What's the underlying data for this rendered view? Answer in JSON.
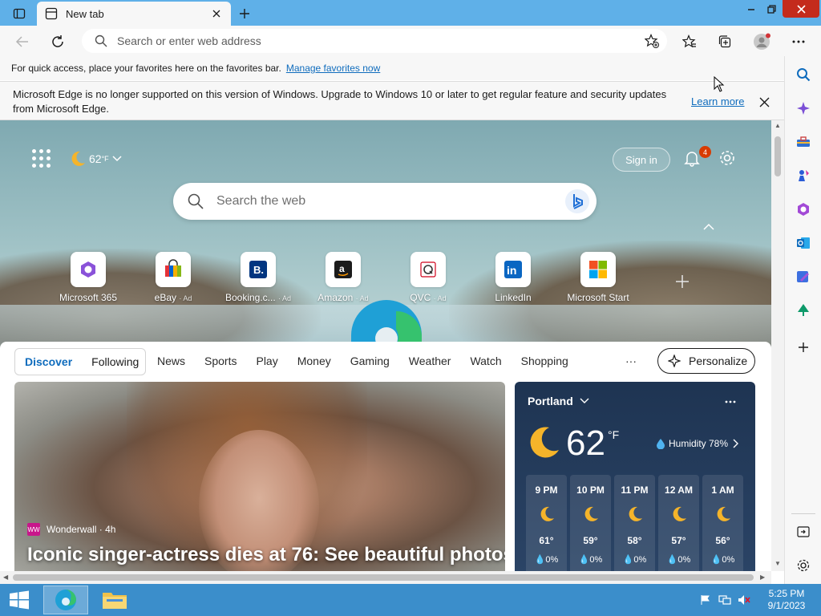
{
  "browser": {
    "tab": {
      "title": "New tab"
    },
    "address": {
      "placeholder": "Search or enter web address"
    },
    "favorites_bar": {
      "text": "For quick access, place your favorites here on the favorites bar.",
      "link": "Manage favorites now"
    },
    "infobar": {
      "text": "Microsoft Edge is no longer supported on this version of Windows. Upgrade to Windows 10 or later to get regular feature and security updates from Microsoft Edge.",
      "link": "Learn more"
    }
  },
  "newtab": {
    "weather_mini": {
      "temp": "62",
      "unit": "°F"
    },
    "sign_in": "Sign in",
    "notification_count": "4",
    "search_placeholder": "Search the web",
    "quick_links": [
      {
        "label": "Microsoft 365",
        "ad": ""
      },
      {
        "label": "eBay",
        "ad": "· Ad"
      },
      {
        "label": "Booking.c...",
        "ad": "· Ad"
      },
      {
        "label": "Amazon",
        "ad": "· Ad"
      },
      {
        "label": "QVC",
        "ad": "· Ad"
      },
      {
        "label": "LinkedIn",
        "ad": ""
      },
      {
        "label": "Microsoft Start",
        "ad": ""
      }
    ]
  },
  "feed": {
    "tabs": [
      "Discover",
      "Following"
    ],
    "nav": [
      "News",
      "Sports",
      "Play",
      "Money",
      "Gaming",
      "Weather",
      "Watch",
      "Shopping"
    ],
    "more": "···",
    "personalize": "Personalize",
    "hero": {
      "source": "Wonderwall · 4h",
      "source_logo": "WW",
      "headline": "Iconic singer-actress dies at 76: See beautiful photos"
    },
    "weather": {
      "city": "Portland",
      "temp": "62",
      "unit": "°F",
      "humidity": "Humidity 78%",
      "hours": [
        {
          "time": "9 PM",
          "temp": "61°",
          "rain": "0%"
        },
        {
          "time": "10 PM",
          "temp": "59°",
          "rain": "0%"
        },
        {
          "time": "11 PM",
          "temp": "58°",
          "rain": "0%"
        },
        {
          "time": "12 AM",
          "temp": "57°",
          "rain": "0%"
        },
        {
          "time": "1 AM",
          "temp": "56°",
          "rain": "0%"
        }
      ]
    }
  },
  "taskbar": {
    "time": "5:25 PM",
    "date": "9/1/2023"
  },
  "colors": {
    "accent": "#0f6cbd",
    "titlebar": "#5fb0e8",
    "taskbar": "#3b8ecb",
    "close": "#c42b1c"
  },
  "icons": [
    "tab-actions-icon",
    "edge-tab-icon",
    "close-icon",
    "plus-icon",
    "minimize-icon",
    "restore-icon",
    "back-icon",
    "refresh-icon",
    "search-icon",
    "add-favorite-icon",
    "favorites-icon",
    "collections-icon",
    "profile-icon",
    "more-icon"
  ]
}
